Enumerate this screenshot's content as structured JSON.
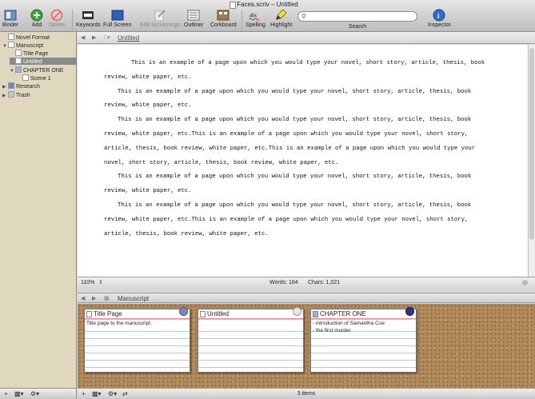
{
  "window": {
    "title": "Faces.scriv – Untitled"
  },
  "toolbar": {
    "binder": "Binder",
    "add": "Add",
    "delete": "Delete",
    "keywords": "Keywords",
    "full_screen": "Full Screen",
    "edit_scrivenings": "Edit Scrivenings",
    "outliner": "Outliner",
    "corkboard": "Corkboard",
    "spelling": "Spelling",
    "highlight": "Highlight",
    "search_label": "Search",
    "search_placeholder": "",
    "inspector": "Inspector"
  },
  "binder": {
    "items": [
      {
        "label": "Novel Format"
      },
      {
        "label": "Manuscript"
      },
      {
        "label": "Title Page"
      },
      {
        "label": "Untitled"
      },
      {
        "label": "CHAPTER ONE"
      },
      {
        "label": "Scene 1"
      },
      {
        "label": "Research"
      },
      {
        "label": "Trash"
      }
    ]
  },
  "editor": {
    "doc_title": "Untitled",
    "paragraphs": [
      "This is an example of a page upon which you would type your novel, short story, article, thesis, book review, white paper, etc.",
      "This is an example of a page upon which you would type your novel, short story, article, thesis, book review, white paper, etc.",
      "This is an example of a page upon which you would type your novel, short story, article, thesis, book review, white paper, etc.This is an example of a page upon which you would type your novel, short story, article, thesis, book review, white paper, etc.This is an example of a page upon which you would type your novel, short story, article, thesis, book review, white paper, etc.",
      "This is an example of a page upon which you would type your novel, short story, article, thesis, book review, white paper, etc.",
      "This is an example of a page upon which you would type your novel, short story, article, thesis, book review, white paper, etc.This is an example of a page upon which you would type your novel, short story, article, thesis, book review, white paper, etc."
    ],
    "zoom": "110%",
    "words": "Words: 184",
    "chars": "Chars: 1,021"
  },
  "corkboard": {
    "title": "Manuscript",
    "cards": [
      {
        "title": "Title Page",
        "synopsis": "Title page to the manuscript.",
        "pin_color": "#7c86b8"
      },
      {
        "title": "Untitled",
        "synopsis": "",
        "pin_color": "#e8e8e8"
      },
      {
        "title": "CHAPTER ONE",
        "synopsis": "- introduction of Samantha Coe\n- the first murder",
        "pin_color": "#2a3590"
      }
    ],
    "items_count": "3 items"
  }
}
